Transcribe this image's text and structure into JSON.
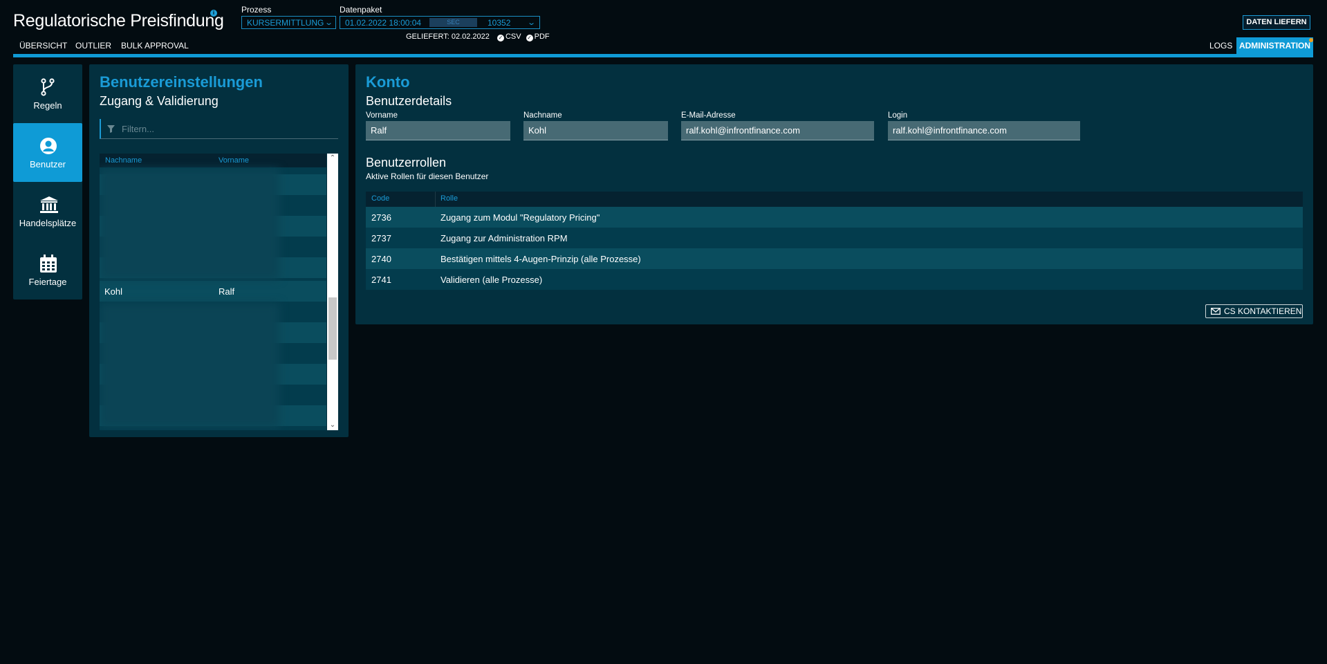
{
  "app": {
    "title": "Regulatorische Preisfindung",
    "info_icon": "i"
  },
  "header": {
    "prozess_label": "Prozess",
    "prozess_value": "KURSERMITTLUNG",
    "paket_label": "Datenpaket",
    "paket_date": "01.02.2022 18:00:04",
    "paket_badge": "SEC",
    "paket_id": "10352",
    "geliefert_label": "GELIEFERT:",
    "geliefert_date": "02.02.2022",
    "csv_label": "CSV",
    "pdf_label": "PDF",
    "daten_button": "DATEN LIEFERN"
  },
  "nav": {
    "items": [
      "ÜBERSICHT",
      "OUTLIER",
      "BULK APPROVAL"
    ],
    "logs": "LOGS",
    "admin": "ADMINISTRATION"
  },
  "sidebar": {
    "items": [
      {
        "label": "Regeln",
        "icon": "branch-icon",
        "active": false
      },
      {
        "label": "Benutzer",
        "icon": "user-icon",
        "active": true
      },
      {
        "label": "Handelsplätze",
        "icon": "bank-icon",
        "active": false
      },
      {
        "label": "Feiertage",
        "icon": "calendar-icon",
        "active": false
      }
    ]
  },
  "left_panel": {
    "title": "Benutzereinstellungen",
    "subtitle": "Zugang & Validierung",
    "filter_placeholder": "Filtern...",
    "columns": [
      "Nachname",
      "Vorname"
    ],
    "selected_row": {
      "nachname": "Kohl",
      "vorname": "Ralf"
    }
  },
  "konto": {
    "title": "Konto",
    "details_title": "Benutzerdetails",
    "fields": [
      {
        "label": "Vorname",
        "value": "Ralf"
      },
      {
        "label": "Nachname",
        "value": "Kohl"
      },
      {
        "label": "E-Mail-Adresse",
        "value": "ralf.kohl@infrontfinance.com"
      },
      {
        "label": "Login",
        "value": "ralf.kohl@infrontfinance.com"
      }
    ],
    "roles_title": "Benutzerrollen",
    "roles_subtitle": "Aktive Rollen für diesen Benutzer",
    "role_columns": [
      "Code",
      "Rolle"
    ],
    "roles": [
      {
        "code": "2736",
        "rolle": "Zugang zum Modul \"Regulatory Pricing\""
      },
      {
        "code": "2737",
        "rolle": "Zugang zur Administration RPM"
      },
      {
        "code": "2740",
        "rolle": "Bestätigen mittels 4-Augen-Prinzip (alle Prozesse)"
      },
      {
        "code": "2741",
        "rolle": "Validieren (alle Prozesse)"
      }
    ],
    "cs_button": "CS KONTAKTIEREN"
  },
  "colors": {
    "accent": "#0f9bd6",
    "panel": "#03303f",
    "background": "#030c11"
  }
}
